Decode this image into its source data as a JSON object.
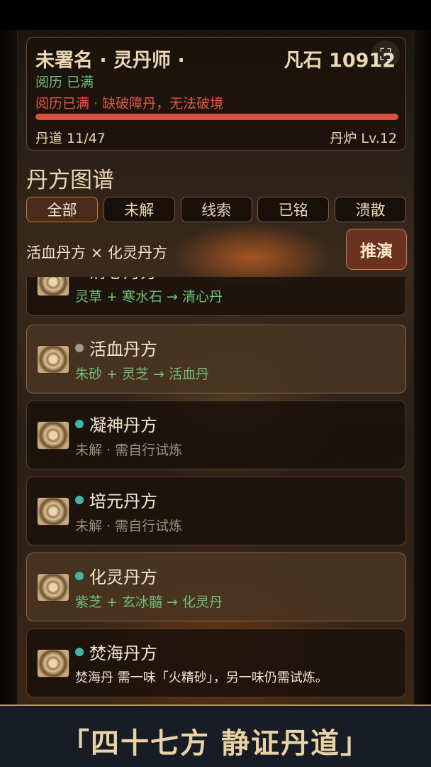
{
  "header": {
    "title": "未署名 · 灵丹师 ·",
    "stones": "凡石 10912",
    "status": "阅历 已满",
    "warning": "阅历已满 · 缺破障丹，无法破境",
    "progress": 1.0,
    "dan_dao": "丹道 11/47",
    "furnace": "丹炉 Lv.12",
    "expand_icon": "expand-icon"
  },
  "section_title": "丹方图谱",
  "tabs": [
    {
      "label": "全部",
      "active": true
    },
    {
      "label": "未解",
      "active": false
    },
    {
      "label": "线索",
      "active": false
    },
    {
      "label": "已铭",
      "active": false
    },
    {
      "label": "溃散",
      "active": false
    }
  ],
  "combo": {
    "label": "活血丹方 × 化灵丹方",
    "button": "推演"
  },
  "recipes": [
    {
      "title": "清心丹方",
      "subtitle": "灵草 + 寒水石 → 清心丹",
      "dot": "teal"
    },
    {
      "title": "活血丹方",
      "subtitle": "朱砂 + 灵芝 → 活血丹",
      "dot": "gray"
    },
    {
      "title": "凝神丹方",
      "subtitle": "未解 · 需自行试炼",
      "dot": "teal"
    },
    {
      "title": "培元丹方",
      "subtitle": "未解 · 需自行试炼",
      "dot": "teal"
    },
    {
      "title": "化灵丹方",
      "subtitle": "紫芝 + 玄冰髓 → 化灵丹",
      "dot": "teal"
    },
    {
      "title": "焚海丹方",
      "subtitle": "焚海丹 需一味「火精砂」，另一味仍需试炼。",
      "dot": "teal"
    }
  ],
  "footer": "「四十七方 静证丹道」",
  "colors": {
    "accent_red": "#d8513c",
    "success_green": "#6fbf7a",
    "teal_dot": "#3fb8a8",
    "gold_text": "#ead7b4"
  }
}
